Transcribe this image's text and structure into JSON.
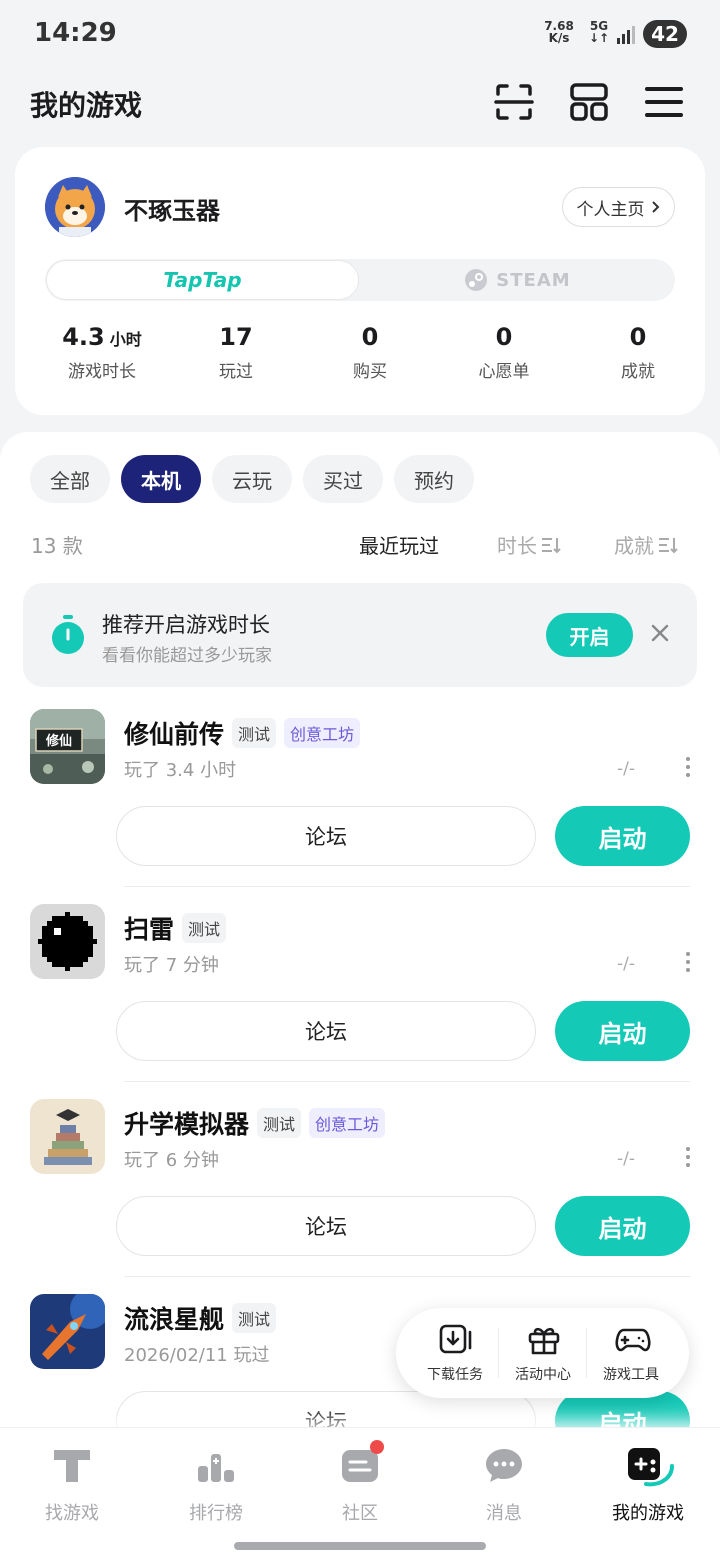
{
  "status_bar": {
    "time": "14:29",
    "speed_value": "7.68",
    "speed_unit": "K/s",
    "network": "5G",
    "battery": "42"
  },
  "header": {
    "title": "我的游戏"
  },
  "profile": {
    "username": "不琢玉器",
    "home_button": "个人主页",
    "platforms": {
      "taptap": "TapTap",
      "steam": "STEAM",
      "selected": "TapTap"
    },
    "stats": [
      {
        "value": "4.3",
        "unit": "小时",
        "label": "游戏时长"
      },
      {
        "value": "17",
        "unit": "",
        "label": "玩过"
      },
      {
        "value": "0",
        "unit": "",
        "label": "购买"
      },
      {
        "value": "0",
        "unit": "",
        "label": "心愿单"
      },
      {
        "value": "0",
        "unit": "",
        "label": "成就"
      }
    ]
  },
  "filters": {
    "chips": [
      "全部",
      "本机",
      "云玩",
      "买过",
      "预约"
    ],
    "active": "本机"
  },
  "list_meta": {
    "count": "13 款",
    "sort_options": [
      "最近玩过",
      "时长",
      "成就"
    ],
    "active_sort": "最近玩过"
  },
  "reco_banner": {
    "title": "推荐开启游戏时长",
    "subtitle": "看看你能超过多少玩家",
    "button": "开启"
  },
  "games": [
    {
      "name": "修仙前传",
      "tags": [
        "测试",
        "创意工坊"
      ],
      "played": "玩了 3.4 小时",
      "ratio": "-/-",
      "icon_text": "修仙",
      "forum": "论坛",
      "launch": "启动"
    },
    {
      "name": "扫雷",
      "tags": [
        "测试"
      ],
      "played": "玩了 7 分钟",
      "ratio": "-/-",
      "forum": "论坛",
      "launch": "启动"
    },
    {
      "name": "升学模拟器",
      "tags": [
        "测试",
        "创意工坊"
      ],
      "played": "玩了 6 分钟",
      "ratio": "-/-",
      "forum": "论坛",
      "launch": "启动"
    },
    {
      "name": "流浪星舰",
      "tags": [
        "测试"
      ],
      "played": "2026/02/11 玩过",
      "ratio": "",
      "forum": "论坛",
      "launch": "启动"
    }
  ],
  "tools": [
    {
      "label": "下载任务",
      "icon": "download-icon"
    },
    {
      "label": "活动中心",
      "icon": "gift-icon"
    },
    {
      "label": "游戏工具",
      "icon": "gamepad-icon"
    }
  ],
  "bottom_nav": [
    {
      "label": "找游戏",
      "icon": "taptap-t-icon"
    },
    {
      "label": "排行榜",
      "icon": "ranking-icon"
    },
    {
      "label": "社区",
      "icon": "community-icon",
      "badge": true
    },
    {
      "label": "消息",
      "icon": "message-icon"
    },
    {
      "label": "我的游戏",
      "icon": "my-games-icon",
      "active": true
    }
  ],
  "colors": {
    "accent": "#15c9b7",
    "chip_active": "#1e237a",
    "tag_purple": "#6b5ad8",
    "badge": "#f04b4b"
  }
}
